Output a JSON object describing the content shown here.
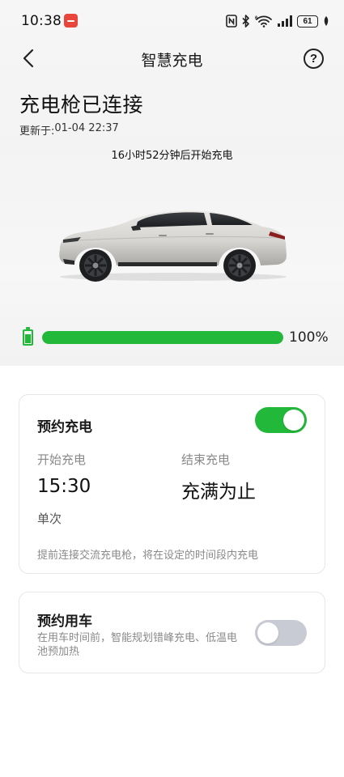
{
  "status_bar": {
    "time": "10:38",
    "battery_level": "61",
    "icons": [
      "nfc-icon",
      "bluetooth-icon",
      "wifi-6-icon",
      "signal-icon",
      "battery-icon",
      "leaf-icon"
    ]
  },
  "nav": {
    "title": "智慧充电",
    "back_icon": "chevron-left-icon",
    "help_label": "?"
  },
  "charging": {
    "status": "充电枪已连接",
    "updated_label": "更新于:",
    "updated_time": "01-04 22:37",
    "start_hint": "16小时52分钟后开始充电",
    "progress_fraction": 1.0,
    "progress_text": "100%",
    "accent_color": "#22b83a"
  },
  "scheduled_charging": {
    "title": "预约充电",
    "enabled": true,
    "start_label": "开始充电",
    "start_value": "15:30",
    "end_label": "结束充电",
    "end_value": "充满为止",
    "repeat": "单次",
    "note": "提前连接交流充电枪，将在设定的时间段内充电"
  },
  "scheduled_trip": {
    "title": "预约用车",
    "enabled": false,
    "description": "在用车时间前，智能规划错峰充电、低温电池预加热"
  }
}
